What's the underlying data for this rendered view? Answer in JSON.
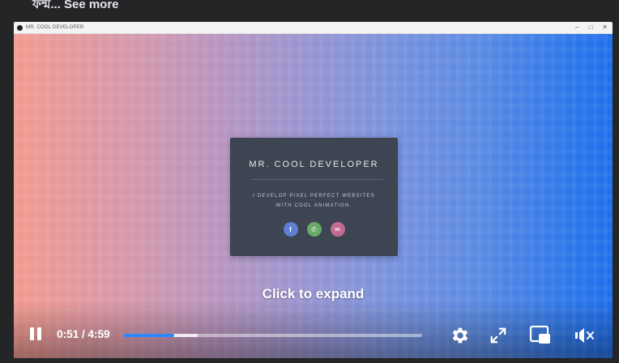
{
  "post": {
    "caption_tail": "ফন্ম... See more"
  },
  "window": {
    "title": "MR. COOL DEVELOPER",
    "minimize": "–",
    "maximize": "□",
    "close": "✕"
  },
  "card": {
    "title": "MR. COOL DEVELOPER",
    "subtitle_line1": "I DEVELOP PIXEL PERFECT WEBSITES",
    "subtitle_line2": "WITH COOL ANIMATION.",
    "social": [
      {
        "icon": "facebook-icon",
        "glyph": "f",
        "color": "#5f7fd1"
      },
      {
        "icon": "phone-icon",
        "glyph": "✆",
        "color": "#6aaa68"
      },
      {
        "icon": "mail-icon",
        "glyph": "✉",
        "color": "#c36a93"
      }
    ]
  },
  "overlay": {
    "click_to_expand": "Click to expand"
  },
  "controls": {
    "time_display": "0:51 / 4:59",
    "progress_played_fraction": 0.17,
    "progress_buffered_fraction": 0.25,
    "accent_color": "#2d88ff",
    "buttons": [
      "pause-icon",
      "gear-icon",
      "fullscreen-icon",
      "picture-in-picture-icon",
      "volume-muted-icon"
    ]
  }
}
